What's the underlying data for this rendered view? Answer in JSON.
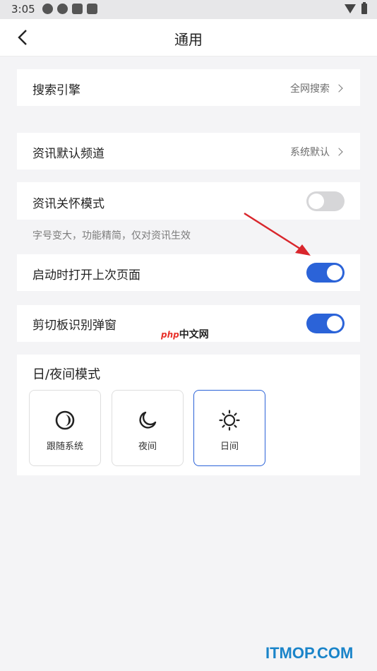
{
  "status_bar": {
    "time": "3:05"
  },
  "nav": {
    "title": "通用"
  },
  "settings": {
    "search_engine": {
      "label": "搜索引擎",
      "value": "全网搜索"
    },
    "news_channel": {
      "label": "资讯默认频道",
      "value": "系统默认"
    },
    "care_mode": {
      "label": "资讯关怀模式",
      "enabled": false,
      "hint": "字号变大，功能精简，仅对资讯生效"
    },
    "restore_last": {
      "label": "启动时打开上次页面",
      "enabled": true
    },
    "clipboard_popup": {
      "label": "剪切板识别弹窗",
      "enabled": true
    }
  },
  "theme_mode": {
    "title": "日/夜间模式",
    "options": [
      {
        "label": "跟随系统",
        "icon": "follow-system-icon",
        "selected": false
      },
      {
        "label": "夜间",
        "icon": "moon-icon",
        "selected": false
      },
      {
        "label": "日间",
        "icon": "sun-icon",
        "selected": true
      }
    ]
  },
  "watermark": {
    "logo": "php",
    "text": "中文网"
  },
  "corner_watermark": "ITMOP.COM",
  "colors": {
    "accent": "#2b63d8",
    "toggle_off": "#d6d6d8",
    "background": "#f4f4f6",
    "arrow": "#d9262c"
  }
}
